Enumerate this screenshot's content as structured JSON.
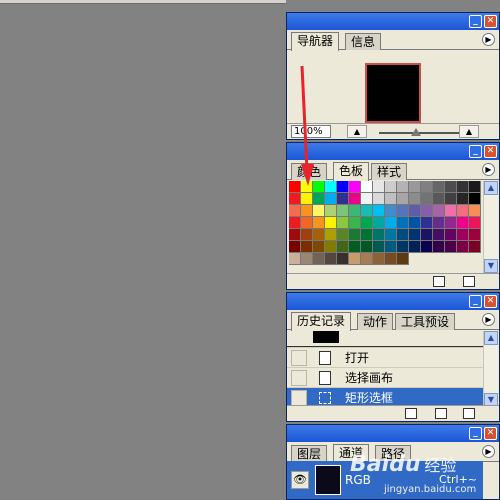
{
  "navigator_panel": {
    "tabs": [
      {
        "label": "导航器"
      },
      {
        "label": "信息"
      }
    ],
    "zoom": "100%"
  },
  "color_panel": {
    "tabs": [
      {
        "label": "颜色"
      },
      {
        "label": "色板"
      },
      {
        "label": "样式"
      }
    ],
    "swatch_rows": [
      [
        "#ff0000",
        "#ffff00",
        "#00ff00",
        "#00ffff",
        "#0000ff",
        "#ff00ff",
        "#ffffff",
        "#e6e6e6",
        "#cccccc",
        "#b3b3b3",
        "#999999",
        "#808080",
        "#666666",
        "#4d4d4d",
        "#333333",
        "#1a1a1a"
      ],
      [
        "#ed1c24",
        "#fff200",
        "#00a651",
        "#00aeef",
        "#2e3192",
        "#ec008c",
        "#f2f2f2",
        "#d9d9d9",
        "#bfbfbf",
        "#a6a6a6",
        "#8c8c8c",
        "#737373",
        "#595959",
        "#404040",
        "#262626",
        "#000000"
      ],
      [
        "#f26c4f",
        "#f7941d",
        "#fff568",
        "#acd373",
        "#7cc576",
        "#3bb878",
        "#1abbb4",
        "#00bff3",
        "#438ccb",
        "#5574b9",
        "#605ca8",
        "#855fa8",
        "#a763a8",
        "#f06eaa",
        "#f26d7d",
        "#f68e56"
      ],
      [
        "#ed1c24",
        "#f26522",
        "#f7941d",
        "#fff200",
        "#8dc63f",
        "#39b54a",
        "#00a651",
        "#00a99d",
        "#00aeef",
        "#0072bc",
        "#0054a6",
        "#2e3192",
        "#662d91",
        "#92278f",
        "#ec008c",
        "#ed145b"
      ],
      [
        "#9e0b0f",
        "#a0410d",
        "#a36209",
        "#aba000",
        "#598527",
        "#1a7b30",
        "#007236",
        "#00746b",
        "#0076a3",
        "#004b80",
        "#003471",
        "#1b1464",
        "#440e62",
        "#630460",
        "#9e005d",
        "#9e0039"
      ],
      [
        "#790000",
        "#7b2e00",
        "#7d4900",
        "#827b00",
        "#406618",
        "#005e20",
        "#005826",
        "#005952",
        "#005b7f",
        "#003663",
        "#002157",
        "#0d004c",
        "#32004b",
        "#4b0049",
        "#7b0046",
        "#7a0026"
      ],
      [
        "#c7b299",
        "#998675",
        "#736357",
        "#534741",
        "#37302d",
        "#c69c6d",
        "#a67c52",
        "#8c6239",
        "#754c24",
        "#603913"
      ]
    ]
  },
  "history_panel": {
    "tabs": [
      {
        "label": "历史记录"
      },
      {
        "label": "动作"
      },
      {
        "label": "工具预设"
      }
    ],
    "items": [
      {
        "label": "打开"
      },
      {
        "label": "选择画布"
      },
      {
        "label": "矩形选框"
      }
    ]
  },
  "layers_panel": {
    "tabs": [
      {
        "label": "图层"
      },
      {
        "label": "通道"
      },
      {
        "label": "路径"
      }
    ],
    "layer": {
      "label": "RGB",
      "shortcut": "Ctrl+~"
    }
  },
  "watermark": {
    "brand": "Baidu",
    "cn": "经验",
    "url": "jingyan.baidu.com"
  },
  "annotation_arrow_color": "#e8232a"
}
